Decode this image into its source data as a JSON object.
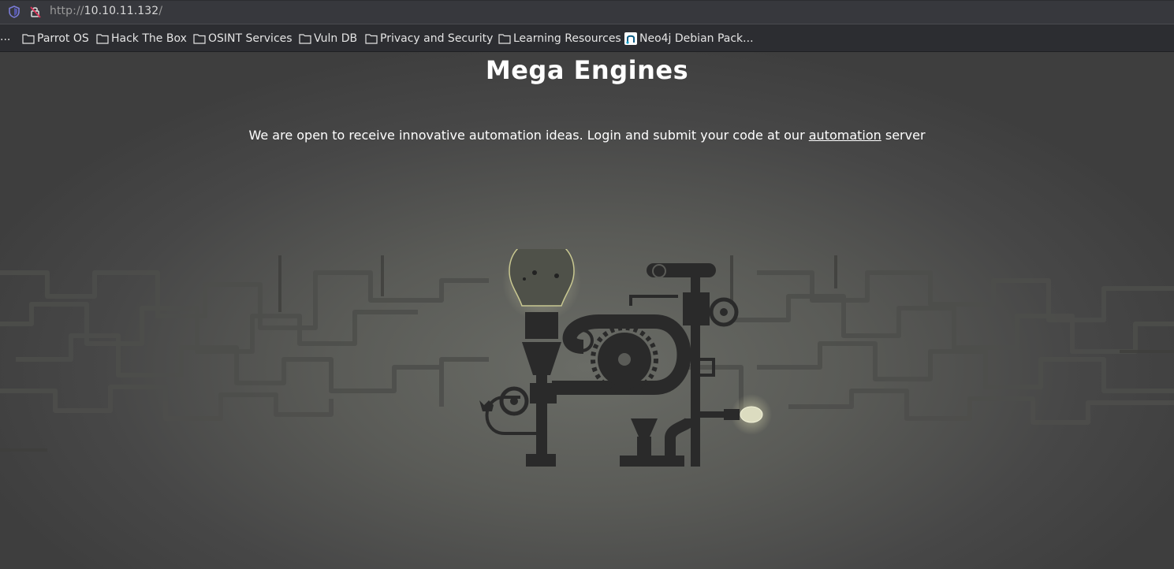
{
  "browser": {
    "url_scheme": "http://",
    "url_host": "10.10.11.132",
    "url_path": "/",
    "bookmarks_overflow": "...",
    "bookmarks": [
      {
        "label": "Parrot OS",
        "icon": "folder-icon"
      },
      {
        "label": "Hack The Box",
        "icon": "folder-icon"
      },
      {
        "label": "OSINT Services",
        "icon": "folder-icon"
      },
      {
        "label": "Vuln DB",
        "icon": "folder-icon"
      },
      {
        "label": "Privacy and Security",
        "icon": "folder-icon"
      },
      {
        "label": "Learning Resources",
        "icon": "folder-icon"
      },
      {
        "label": "Neo4j Debian Pack...",
        "icon": "neo4j-favicon-icon"
      }
    ]
  },
  "page": {
    "title": "Mega Engines",
    "intro_before": "We are open to receive innovative automation ideas. Login and submit your code at our ",
    "link_text": "automation",
    "intro_after": " server"
  }
}
